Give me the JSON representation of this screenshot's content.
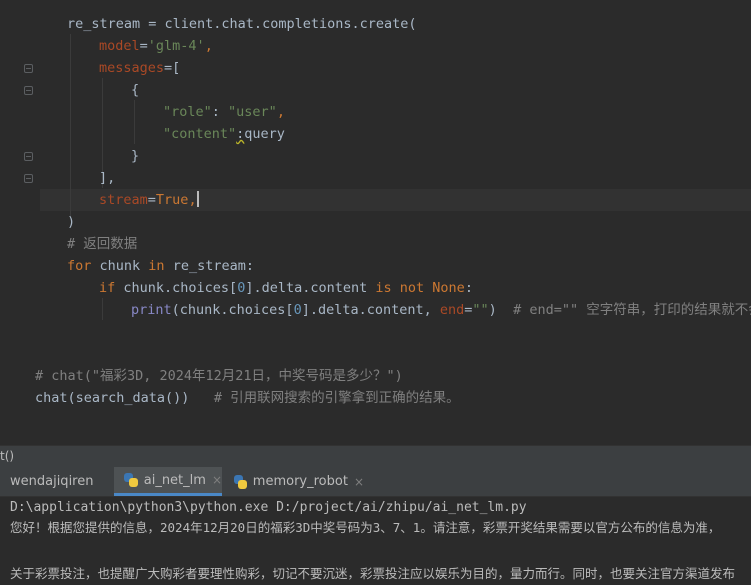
{
  "editor": {
    "lines": {
      "l1": {
        "p1": "re_stream = client.chat.completions.create("
      },
      "l2": {
        "param": "model",
        "eq": "=",
        "str": "'glm-4'",
        "comma": ","
      },
      "l3": {
        "param": "messages",
        "rest": "=["
      },
      "l4": {
        "text": "{"
      },
      "l5": {
        "key": "\"role\"",
        "colon": ": ",
        "val": "\"user\"",
        "comma": ","
      },
      "l6": {
        "key": "\"content\"",
        "colon": ":",
        "val": "query"
      },
      "l7": {
        "text": "}"
      },
      "l8": {
        "text": "],"
      },
      "l9": {
        "param": "stream",
        "eq": "=",
        "kw": "True",
        "comma": ","
      },
      "l10": {
        "text": ")"
      },
      "l11": {
        "comment": "# 返回数据"
      },
      "l12": {
        "kw1": "for",
        "mid1": " chunk ",
        "kw2": "in",
        "mid2": " re_stream:"
      },
      "l13": {
        "kw1": "if",
        "mid1": " chunk.choices[",
        "num": "0",
        "mid2": "].delta.content ",
        "kw2": "is not",
        "sp": " ",
        "kw3": "None",
        "end": ":"
      },
      "l14": {
        "fn": "print",
        "p1": "(chunk.choices[",
        "num": "0",
        "p2": "].delta.content, ",
        "param": "end",
        "eq": "=",
        "str": "\"\"",
        "close": ")  ",
        "comment": "# end=\"\" 空字符串，打印的结果就不会换行"
      },
      "l15": {
        "comment": "# chat(\"福彩3D, 2024年12月21日，中奖号码是多少？\")"
      },
      "l16": {
        "code": "chat(search_data())",
        "pad": "   ",
        "comment": "# 引用联网搜索的引擎拿到正确的结果。"
      }
    }
  },
  "runbar": {
    "label": "t()"
  },
  "tabs": [
    {
      "label": "wendajiqiren"
    },
    {
      "label": "ai_net_lm",
      "close": "×"
    },
    {
      "label": "memory_robot",
      "close": "×"
    }
  ],
  "console": {
    "command": "D:\\application\\python3\\python.exe D:/project/ai/zhipu/ai_net_lm.py",
    "out1": "您好！根据您提供的信息，2024年12月20日的福彩3D中奖号码为3、7、1。请注意，彩票开奖结果需要以官方公布的信息为准，",
    "out2": "关于彩票投注，也提醒广大购彩者要理性购彩，切记不要沉迷，彩票投注应以娱乐为目的，量力而行。同时，也要关注官方渠道发布"
  },
  "colors": {
    "background": "#2b2b2b",
    "keyword": "#cc7832",
    "string": "#6a8759",
    "number": "#6897bb",
    "param": "#aa4926",
    "comment": "#808080",
    "text": "#a9b7c6"
  }
}
